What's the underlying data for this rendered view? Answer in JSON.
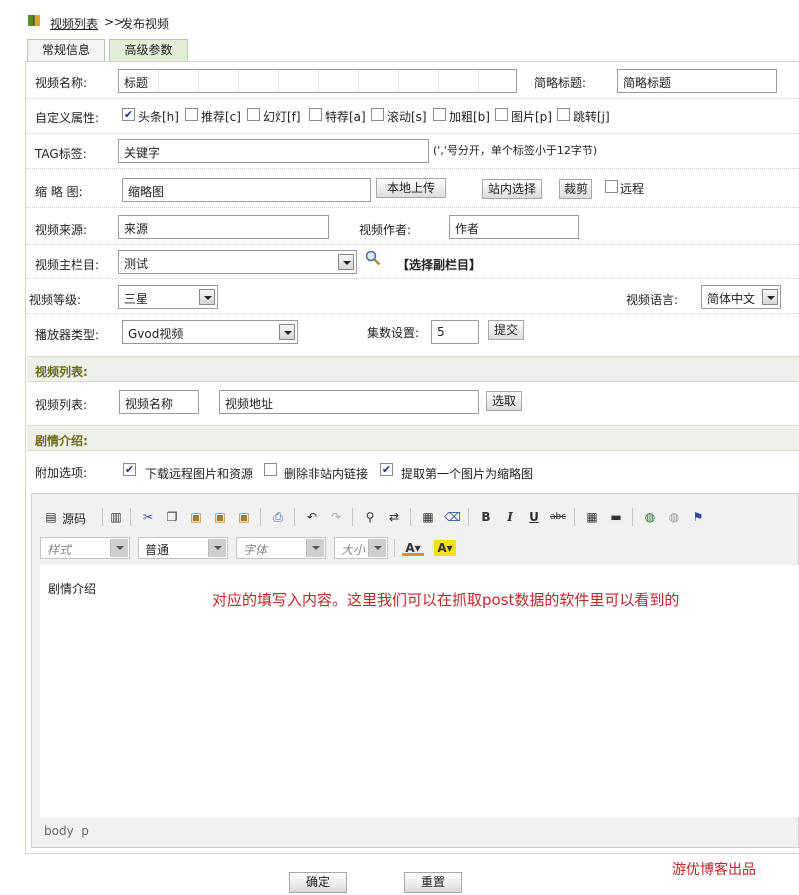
{
  "breadcrumb": {
    "list_link": "视频列表",
    "sep": ">>",
    "current": "发布视频"
  },
  "tabs": [
    {
      "label": "常规信息"
    },
    {
      "label": "高级参数"
    }
  ],
  "form": {
    "name_label": "视频名称:",
    "name_value": "标题",
    "short_title_label": "简略标题:",
    "short_title_value": "简略标题",
    "attr_label": "自定义属性:",
    "attrs": [
      {
        "label": "头条[h]",
        "checked": true
      },
      {
        "label": "推荐[c]",
        "checked": false
      },
      {
        "label": "幻灯[f]",
        "checked": false
      },
      {
        "label": "特荐[a]",
        "checked": false
      },
      {
        "label": "滚动[s]",
        "checked": false
      },
      {
        "label": "加粗[b]",
        "checked": false
      },
      {
        "label": "图片[p]",
        "checked": false
      },
      {
        "label": "跳转[j]",
        "checked": false
      }
    ],
    "tag_label": "TAG标签:",
    "tag_value": "关键字",
    "tag_hint": "(','号分开，单个标签小于12字节)",
    "thumb_label": "缩 略 图:",
    "thumb_value": "缩略图",
    "upload_btn": "本地上传",
    "site_select_btn": "站内选择",
    "crop_btn": "裁剪",
    "remote_label": "远程",
    "source_label": "视频来源:",
    "source_value": "来源",
    "author_label": "视频作者:",
    "author_value": "作者",
    "column_label": "视频主栏目:",
    "column_value": "测试",
    "sub_column_link": "【选择副栏目】",
    "level_label": "视频等级:",
    "level_value": "三星",
    "lang_label": "视频语言:",
    "lang_value": "简体中文",
    "player_label": "播放器类型:",
    "player_value": "Gvod视频",
    "episodes_label": "集数设置:",
    "episodes_value": "5",
    "submit_small_btn": "提交"
  },
  "video_list_section": {
    "title": "视频列表:",
    "label": "视频列表:",
    "name_value": "视频名称",
    "url_value": "视频地址",
    "pick_btn": "选取"
  },
  "plot_section": {
    "title": "剧情介绍:"
  },
  "extras": {
    "label": "附加选项:",
    "options": [
      {
        "label": "下载远程图片和资源",
        "checked": true
      },
      {
        "label": "删除非站内链接",
        "checked": false
      },
      {
        "label": "提取第一个图片为缩略图",
        "checked": true
      }
    ]
  },
  "editor": {
    "source_btn": "源码",
    "style_select": "样式",
    "format_select": "普通",
    "font_select": "字体",
    "size_select": "大小",
    "content": "剧情介绍",
    "status_path": "body  p",
    "annotation": "对应的填写入内容。这里我们可以在抓取post数据的软件里可以看到的"
  },
  "footer": {
    "confirm_btn": "确定",
    "reset_btn": "重置",
    "credit": "游优博客出品"
  },
  "colors": {
    "annotation": "#c0282a",
    "section_title": "#6a6a1a",
    "active_tab": "#e2eed6"
  }
}
